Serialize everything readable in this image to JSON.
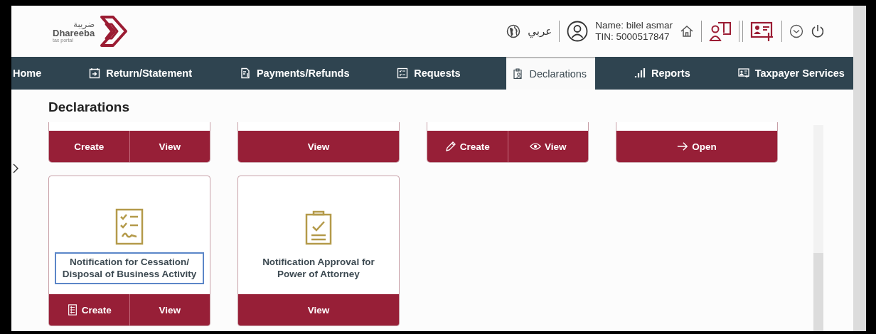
{
  "header": {
    "logo": {
      "arabic": "ضريبة",
      "name": "Dhareeba",
      "tagline": "tax portal"
    },
    "language": "عربي",
    "user": {
      "name": "Name: bilel asmar",
      "tin": "TIN: 5000517847"
    }
  },
  "nav": [
    {
      "label": "Home",
      "kind": "plain",
      "selected": false
    },
    {
      "label": "Return/Statement",
      "kind": "calendar",
      "selected": false
    },
    {
      "label": "Payments/Refunds",
      "kind": "document",
      "selected": false
    },
    {
      "label": "Requests",
      "kind": "checklist",
      "selected": false
    },
    {
      "label": "Declarations",
      "kind": "clipboard",
      "selected": true
    },
    {
      "label": "Reports",
      "kind": "bars",
      "selected": false
    },
    {
      "label": "Taxpayer Services",
      "kind": "card",
      "selected": false
    }
  ],
  "page_title": "Declarations",
  "card_rows": [
    [
      {
        "actions": [
          {
            "label": "Create",
            "kind": "plain"
          },
          {
            "label": "View",
            "kind": "plain"
          }
        ]
      },
      {
        "actions": [
          {
            "label": "View",
            "kind": "plain"
          }
        ]
      },
      {
        "actions": [
          {
            "label": "Create",
            "kind": "pencil"
          },
          {
            "label": "View",
            "kind": "eye"
          }
        ]
      },
      {
        "actions": [
          {
            "label": "Open",
            "kind": "arrow"
          }
        ]
      }
    ],
    [
      {
        "kind": "checklist",
        "title": "Notification for Cessation/ Disposal of Business Activity",
        "focused": true,
        "actions": [
          {
            "label": "Create",
            "kind": "form"
          },
          {
            "label": "View",
            "kind": "plain"
          }
        ]
      },
      {
        "kind": "clipboard",
        "title": "Notification Approval for Power of Attorney",
        "focused": false,
        "actions": [
          {
            "label": "View",
            "kind": "plain"
          }
        ]
      }
    ]
  ]
}
